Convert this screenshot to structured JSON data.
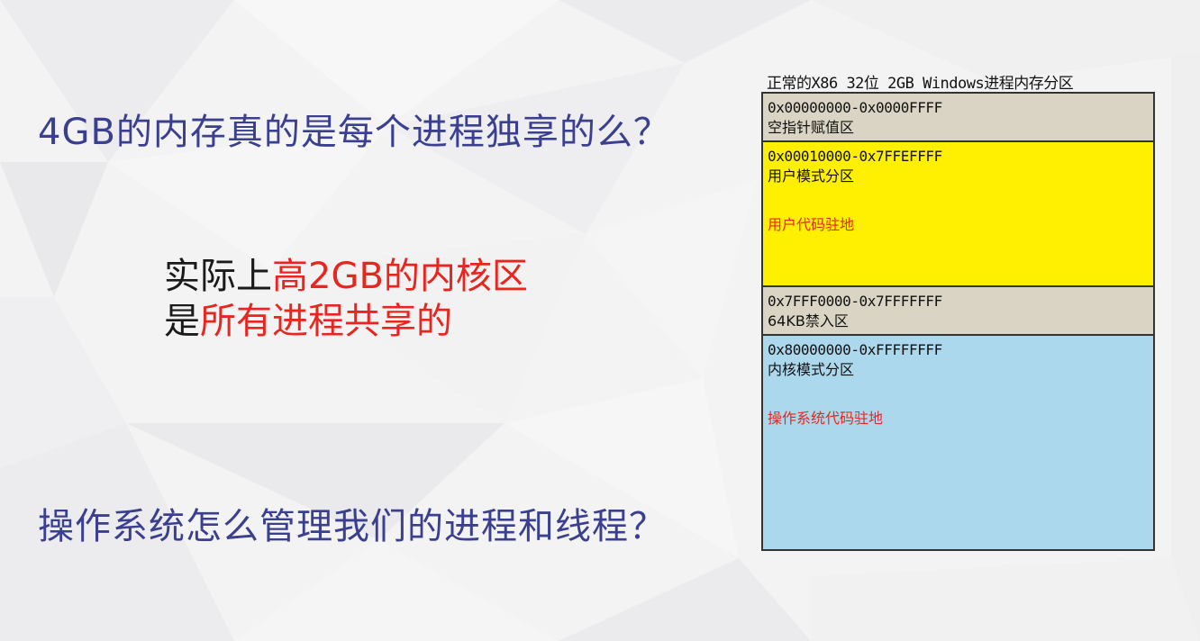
{
  "slide": {
    "question_1": "4GB的内存真的是每个进程独享的么？",
    "kernel_note": {
      "line1_part1": "实际上",
      "line1_part2": "高2GB的内核区",
      "line2_part1": "是",
      "line2_part2": "所有进程共享的"
    },
    "question_2": "操作系统怎么管理我们的进程和线程？"
  },
  "memory_map": {
    "title": "正常的X86 32位 2GB Windows进程内存分区",
    "regions": [
      {
        "range": "0x00000000-0x0000FFFF",
        "name": "空指针赋值区",
        "note": "",
        "color": "#d9d4c4"
      },
      {
        "range": "0x00010000-0x7FFEFFFF",
        "name": "用户模式分区",
        "note": "用户代码驻地",
        "color": "#ffef00"
      },
      {
        "range": "0x7FFF0000-0x7FFFFFFF",
        "name": "64KB禁入区",
        "note": "",
        "color": "#d9d4c4"
      },
      {
        "range": "0x80000000-0xFFFFFFFF",
        "name": "内核模式分区",
        "note": "操作系统代码驻地",
        "color": "#acd8ee"
      }
    ]
  },
  "colors": {
    "question_text": "#3a3f8f",
    "highlight_red": "#e8261f",
    "body_text": "#1a1a1a"
  }
}
